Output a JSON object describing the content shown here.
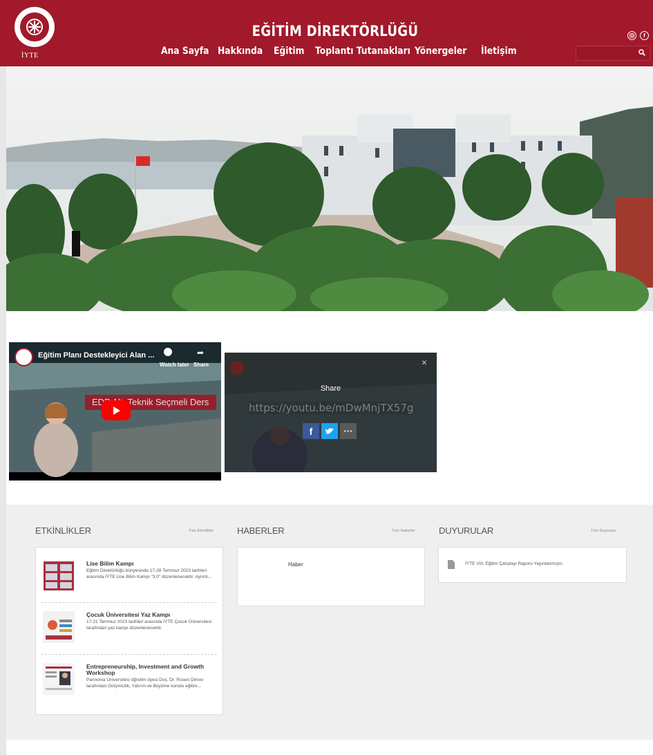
{
  "header": {
    "title": "EĞİTİM DİREKTÖRLÜĞÜ",
    "logo_text": "İYTE",
    "nav": [
      "Ana Sayfa",
      "Hakkında",
      "Eğitim",
      "Toplantı Tutanakları",
      "Yönergeler",
      "İletişim"
    ],
    "search_placeholder": "",
    "colors": {
      "brand": "#a1192b"
    }
  },
  "video": {
    "title": "Eğitim Planı Destekleyici Alan ...",
    "watch_later": "Watch later",
    "share": "Share",
    "caption": "EDP Alt: Teknik Seçmeli Ders"
  },
  "share_panel": {
    "title": "Share",
    "url": "https://youtu.be/mDwMnjTX57g",
    "close": "×"
  },
  "sections": {
    "events": {
      "title": "ETKİNLİKLER",
      "all_link": "Tüm Etkinlikler",
      "items": [
        {
          "title": "Lise Bilim Kampı",
          "text": "Eğitim Direktörlüğü bünyesinde 17-28 Temmuz 2023 tarihleri arasında İYTE Lise Bilim Kampı \"3.0\" düzenlenecektir. Ayrıntı..."
        },
        {
          "title": "Çocuk Üniversitesi Yaz Kampı",
          "text": "17-21 Temmuz 2023 tarihleri arasında İYTE Çocuk Üniversitesi tarafından yaz kampı düzenlenecektir."
        },
        {
          "title": "Entrepreneurship, Investment and Growth Workshop",
          "text": "Pannonia Üniversitesi öğretim üyesi Doç. Dr. Rosen Dimov tarafından Girişimcilik, Yatırım ve Büyüme konulu eğitim..."
        }
      ]
    },
    "news": {
      "title": "HABERLER",
      "all_link": "Tüm Haberler",
      "items": [
        {
          "title": "Haber"
        }
      ]
    },
    "announcements": {
      "title": "DUYURULAR",
      "all_link": "Tüm Duyurular",
      "items": [
        {
          "title": "İYTE VIII. Eğitim Çalıştayı Raporu Yayınlanmıştır."
        }
      ]
    }
  }
}
